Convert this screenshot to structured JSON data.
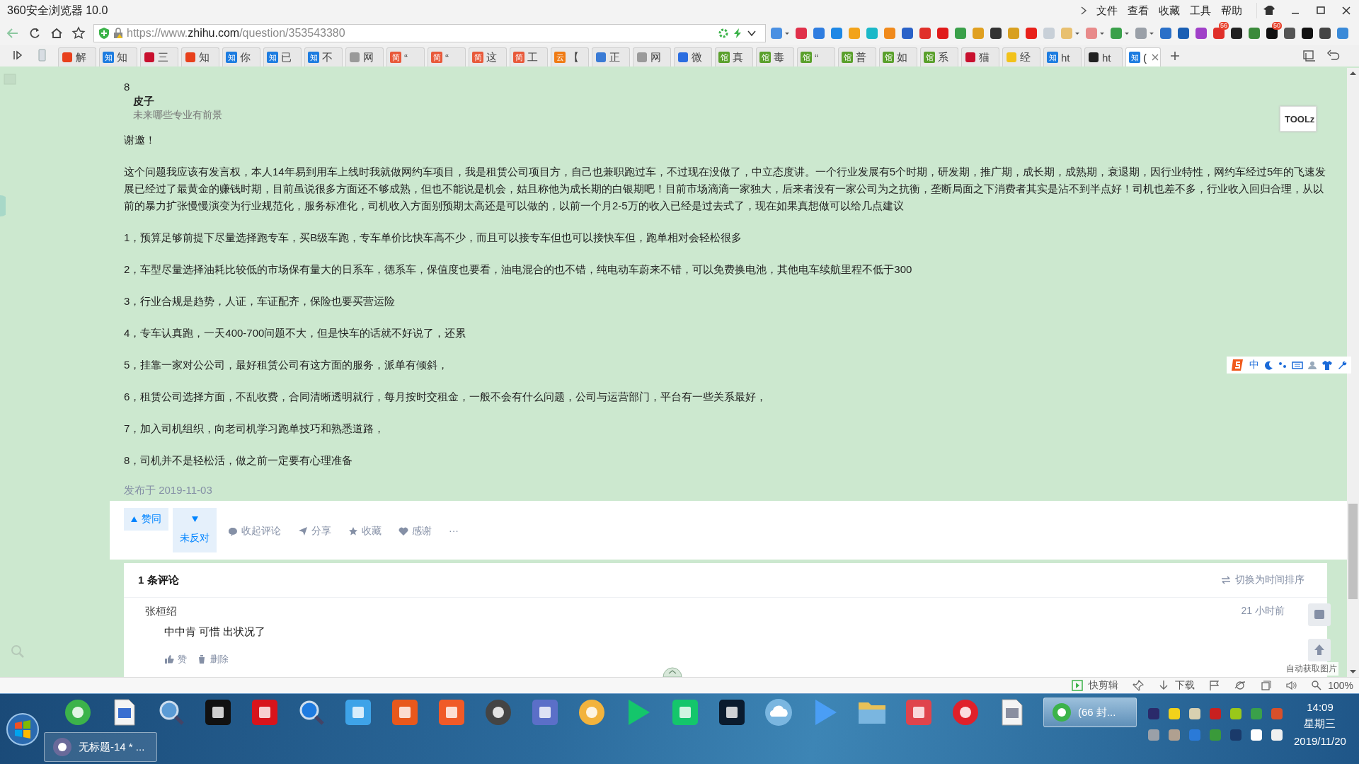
{
  "window": {
    "title": "360安全浏览器 10.0",
    "menu": [
      "文件",
      "查看",
      "收藏",
      "工具",
      "帮助"
    ]
  },
  "address_bar": {
    "url_prefix": "https://www.",
    "url_domain": "zhihu.com",
    "url_path": "/question/353543380"
  },
  "extensions": [
    {
      "color": "#4a90e2",
      "menu": true
    },
    {
      "color": "#e0304a"
    },
    {
      "color": "#2f7de0"
    },
    {
      "color": "#1e88e5"
    },
    {
      "color": "#f2a31a"
    },
    {
      "color": "#1bb8c8"
    },
    {
      "color": "#f08a1c"
    },
    {
      "color": "#2a62c8"
    },
    {
      "color": "#e0302a"
    },
    {
      "color": "#e01a1a"
    },
    {
      "color": "#3aa04a"
    },
    {
      "color": "#e0a020"
    },
    {
      "color": "#333333"
    },
    {
      "color": "#d8a020"
    },
    {
      "color": "#e8201a"
    },
    {
      "color": "#c8d0d8"
    },
    {
      "color": "#e8c070",
      "menu": true
    },
    {
      "color": "#e88a8a",
      "menu": true
    },
    {
      "color": "#3aa04a",
      "menu": true
    },
    {
      "color": "#9aa0a8",
      "menu": true
    },
    {
      "color": "#2a70c8"
    },
    {
      "color": "#1a5fb4"
    },
    {
      "color": "#a040c8"
    },
    {
      "color": "#e0302a",
      "badge": "56"
    },
    {
      "color": "#222222"
    },
    {
      "color": "#3a8a3a"
    },
    {
      "color": "#111111",
      "badge": "50"
    },
    {
      "color": "#555555"
    },
    {
      "color": "#111111"
    },
    {
      "color": "#444444"
    },
    {
      "color": "#3a8ad8"
    }
  ],
  "tabs": [
    {
      "label": "解",
      "color": "#e8401c",
      "selected": false
    },
    {
      "badge": "知",
      "label": "知",
      "color": "#1d7ce0",
      "selected": false
    },
    {
      "label": "三",
      "color": "#c8102e",
      "selected": false
    },
    {
      "label": "知",
      "color": "#e8401c",
      "selected": false
    },
    {
      "badge": "知",
      "label": "你",
      "color": "#1d7ce0",
      "selected": false
    },
    {
      "badge": "知",
      "label": "已",
      "color": "#1d7ce0",
      "selected": false
    },
    {
      "badge": "知",
      "label": "不",
      "color": "#1d7ce0",
      "selected": false
    },
    {
      "label": "网",
      "color": "#9a9a9a",
      "selected": false
    },
    {
      "badge": "简",
      "label": "“",
      "color": "#e8593a",
      "selected": false
    },
    {
      "badge": "简",
      "label": "“",
      "color": "#e8593a",
      "selected": false
    },
    {
      "badge": "简",
      "label": "这",
      "color": "#e8593a",
      "selected": false
    },
    {
      "badge": "简",
      "label": "工",
      "color": "#e8593a",
      "selected": false
    },
    {
      "badge": "云",
      "label": "【",
      "color": "#f07b14",
      "selected": false
    },
    {
      "label": "正",
      "color": "#3a7bd5",
      "selected": false
    },
    {
      "label": "网",
      "color": "#9a9a9a",
      "selected": false
    },
    {
      "label": "微",
      "color": "#2b6de0",
      "selected": false
    },
    {
      "badge": "馆",
      "label": "真",
      "color": "#5aa02c",
      "selected": false
    },
    {
      "badge": "馆",
      "label": "毒",
      "color": "#5aa02c",
      "selected": false
    },
    {
      "badge": "馆",
      "label": "“",
      "color": "#5aa02c",
      "selected": false
    },
    {
      "badge": "馆",
      "label": "普",
      "color": "#5aa02c",
      "selected": false
    },
    {
      "badge": "馆",
      "label": "如",
      "color": "#5aa02c",
      "selected": false
    },
    {
      "badge": "馆",
      "label": "系",
      "color": "#5aa02c",
      "selected": false
    },
    {
      "label": "猫",
      "color": "#c8102e",
      "selected": false
    },
    {
      "label": "经",
      "color": "#f2c21a",
      "selected": false
    },
    {
      "badge": "知",
      "label": "ht",
      "color": "#1d7ce0",
      "selected": false
    },
    {
      "label": "ht",
      "color": "#222222",
      "selected": false
    },
    {
      "badge": "知",
      "label": "(",
      "color": "#1d7ce0",
      "selected": true
    }
  ],
  "tool_button": "TOOLz",
  "answer": {
    "number": "8",
    "author": "皮子",
    "author_subtitle": "未来哪些专业有前景",
    "paragraphs": [
      "谢邀！",
      "这个问题我应该有发言权，本人14年易到用车上线时我就做网约车项目，我是租赁公司项目方，自己也兼职跑过车，不过现在没做了，中立态度讲。一个行业发展有5个时期，研发期，推广期，成长期，成熟期，衰退期，因行业特性，网约车经过5年的飞速发展已经过了最黄金的赚钱时期，目前虽说很多方面还不够成熟，但也不能说是机会，姑且称他为成长期的白银期吧！目前市场滴滴一家独大，后来者没有一家公司为之抗衡，垄断局面之下消费者其实是沾不到半点好！司机也差不多，行业收入回归合理，从以前的暴力扩张慢慢演变为行业规范化，服务标准化，司机收入方面别预期太高还是可以做的，以前一个月2-5万的收入已经是过去式了，现在如果真想做可以给几点建议",
      "1，预算足够前提下尽量选择跑专车，买B级车跑，专车单价比快车高不少，而且可以接专车但也可以接快车但，跑单相对会轻松很多",
      "2，车型尽量选择油耗比较低的市场保有量大的日系车，德系车，保值度也要看，油电混合的也不错，纯电动车蔚来不错，可以免费换电池，其他电车续航里程不低于300",
      "3，行业合规是趋势，人证，车证配齐，保险也要买营运险",
      "4，专车认真跑，一天400-700问题不大，但是快车的话就不好说了，还累",
      "5，挂靠一家对公公司，最好租赁公司有这方面的服务，派单有倾斜，",
      "6，租赁公司选择方面，不乱收费，合同清晰透明就行，每月按时交租金，一般不会有什么问题，公司与运营部门，平台有一些关系最好，",
      "7，加入司机组织，向老司机学习跑单技巧和熟悉道路，",
      "8，司机并不是轻松活，做之前一定要有心理准备"
    ],
    "published": "发布于 2019-11-03"
  },
  "actions": {
    "upvote": "赞同",
    "downvote": "未反对",
    "links": [
      {
        "kind": "comment",
        "label": "收起评论"
      },
      {
        "kind": "share",
        "label": "分享"
      },
      {
        "kind": "star",
        "label": "收藏"
      },
      {
        "kind": "heart",
        "label": "感谢"
      },
      {
        "kind": "more",
        "label": "···"
      }
    ]
  },
  "comments": {
    "title": "1 条评论",
    "sort_link": "切换为时间排序",
    "items": [
      {
        "author": "张桓绍",
        "time": "21 小时前",
        "text": "中中肯 可惜 出状况了",
        "actions": [
          {
            "kind": "like",
            "label": "赞"
          },
          {
            "kind": "delete",
            "label": "删除"
          }
        ]
      }
    ]
  },
  "ime": {
    "mode": "中"
  },
  "auto_image_label": "自动获取图片",
  "status_bar": [
    {
      "kind": "clip",
      "label": "快剪辑"
    },
    {
      "kind": "pin"
    },
    {
      "kind": "download",
      "label": "下载"
    },
    {
      "kind": "flag"
    },
    {
      "kind": "ie"
    },
    {
      "kind": "window"
    },
    {
      "kind": "speaker"
    },
    {
      "kind": "zoom",
      "label": "100%"
    }
  ],
  "taskbar": {
    "pinned": [
      {
        "kind": "circle",
        "color": "#3cb34a"
      },
      {
        "kind": "doc",
        "color": "#3a6fd0"
      },
      {
        "kind": "magnifier",
        "color": "#5a9bd5"
      },
      {
        "kind": "square",
        "color": "#111111"
      },
      {
        "kind": "square",
        "color": "#d8141c"
      },
      {
        "kind": "magnifier",
        "color": "#1e7be0"
      },
      {
        "kind": "square",
        "color": "#3ea3e8"
      },
      {
        "kind": "square",
        "color": "#e8581c"
      },
      {
        "kind": "square",
        "color": "#f05a28"
      },
      {
        "kind": "circle",
        "color": "#444444"
      },
      {
        "kind": "square",
        "color": "#5b6fc8"
      },
      {
        "kind": "circle",
        "color": "#f2b33d"
      },
      {
        "kind": "play",
        "color": "#14c66b"
      },
      {
        "kind": "square",
        "color": "#14c66b"
      },
      {
        "kind": "square",
        "color": "#0a1b2e"
      },
      {
        "kind": "cloud",
        "color": "#7ab6e0"
      },
      {
        "kind": "play",
        "color": "#4a9ef5"
      },
      {
        "kind": "folder",
        "color": "#e8c158"
      },
      {
        "kind": "square",
        "color": "#e0444c"
      },
      {
        "kind": "circle",
        "color": "#e0202a"
      },
      {
        "kind": "doc",
        "color": "#8a8fa0"
      }
    ],
    "windows": [
      {
        "label": "(66 封...",
        "color": "#3cb34a",
        "selected": true
      },
      {
        "label": "无标题-14 * ...",
        "color": "#6a6a9a",
        "selected": false
      }
    ],
    "tray": [
      {
        "color": "#2a2a6a"
      },
      {
        "color": "#f2d21a"
      },
      {
        "color": "#d8d0b0"
      },
      {
        "color": "#c82020"
      },
      {
        "color": "#9ac81a"
      },
      {
        "color": "#3aa04a"
      },
      {
        "color": "#d8502a"
      },
      {
        "color": "#9aa0a8"
      },
      {
        "color": "#b0a090"
      },
      {
        "color": "#2a7ad8"
      },
      {
        "color": "#3a9a3a"
      },
      {
        "color": "#1a3a6a"
      },
      {
        "color": "#ffffff"
      },
      {
        "color": "#f0f0f0"
      }
    ],
    "clock": {
      "time": "14:09",
      "weekday": "星期三",
      "date": "2019/11/20"
    }
  }
}
